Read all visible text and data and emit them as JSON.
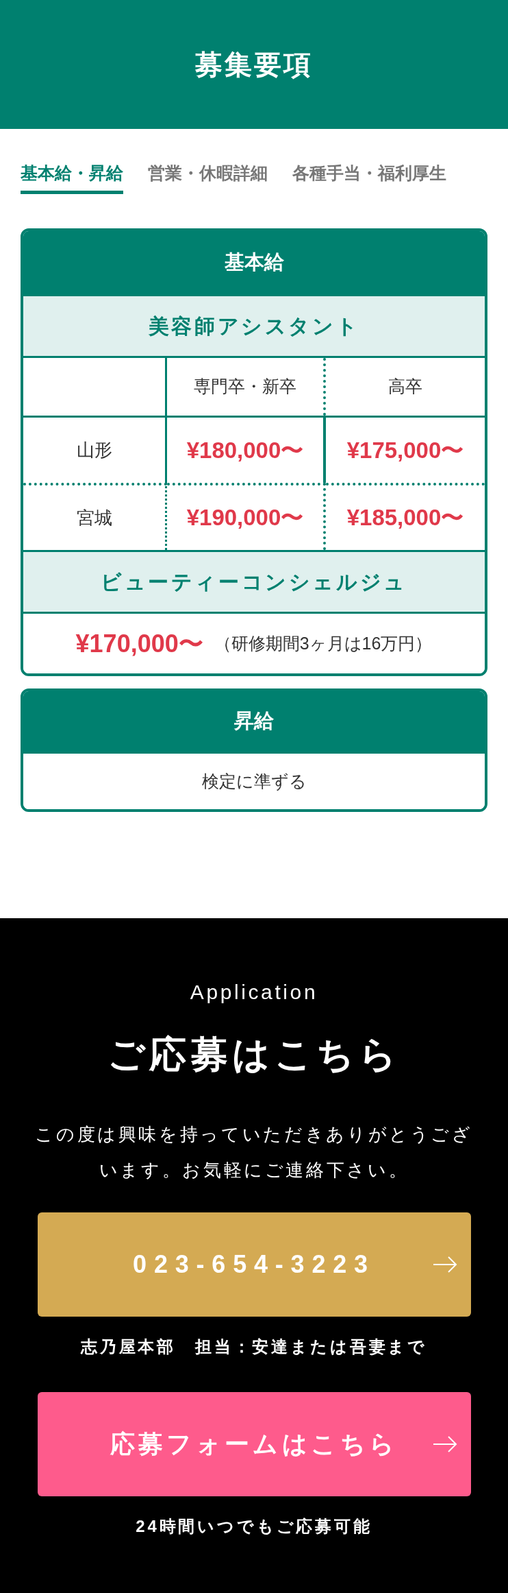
{
  "header": {
    "title": "募集要項"
  },
  "tabs": [
    {
      "label": "基本給・昇給",
      "selected": true
    },
    {
      "label": "営業・休暇詳細",
      "selected": false
    },
    {
      "label": "各種手当・福利厚生",
      "selected": false
    }
  ],
  "salary_card": {
    "title": "基本給",
    "sections": [
      {
        "kind": "table",
        "heading": "美容師アシスタント",
        "columns": [
          "専門卒・新卒",
          "高卒"
        ],
        "rows": [
          {
            "label": "山形",
            "values": [
              "¥180,000〜",
              "¥175,000〜"
            ]
          },
          {
            "label": "宮城",
            "values": [
              "¥190,000〜",
              "¥185,000〜"
            ]
          }
        ]
      },
      {
        "kind": "single",
        "heading": "ビューティーコンシェルジュ",
        "amount": "¥170,000〜",
        "note": "（研修期間3ヶ月は16万円）"
      }
    ]
  },
  "raise_card": {
    "title": "昇給",
    "text": "検定に準ずる"
  },
  "application": {
    "eyebrow": "Application",
    "title": "ご応募はこちら",
    "message": "この度は興味を持っていただきありがとうございます。お気軽にご連絡下さい。",
    "buttons": [
      {
        "kind": "phone",
        "label": "023-654-3223",
        "caption": "志乃屋本部　担当：安達または吾妻まで"
      },
      {
        "kind": "form",
        "label": "応募フォームはこちら",
        "caption": "24時間いつでもご応募可能"
      }
    ]
  }
}
